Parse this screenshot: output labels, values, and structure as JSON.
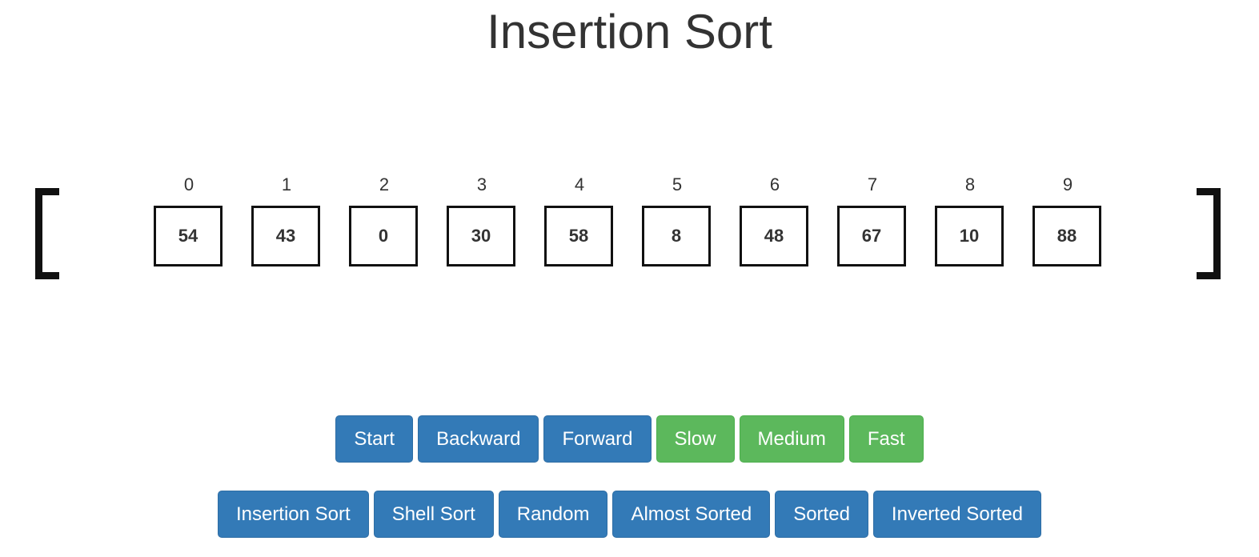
{
  "title": "Insertion Sort",
  "array": {
    "indices": [
      "0",
      "1",
      "2",
      "3",
      "4",
      "5",
      "6",
      "7",
      "8",
      "9"
    ],
    "values": [
      "54",
      "43",
      "0",
      "30",
      "58",
      "8",
      "48",
      "67",
      "10",
      "88"
    ]
  },
  "controls": {
    "start": "Start",
    "backward": "Backward",
    "forward": "Forward",
    "slow": "Slow",
    "medium": "Medium",
    "fast": "Fast"
  },
  "algorithms": {
    "insertion_sort": "Insertion Sort",
    "shell_sort": "Shell Sort",
    "random": "Random",
    "almost_sorted": "Almost Sorted",
    "sorted": "Sorted",
    "inverted_sorted": "Inverted Sorted"
  },
  "colors": {
    "primary": "#337ab7",
    "success": "#5cb85c",
    "text": "#333333"
  }
}
